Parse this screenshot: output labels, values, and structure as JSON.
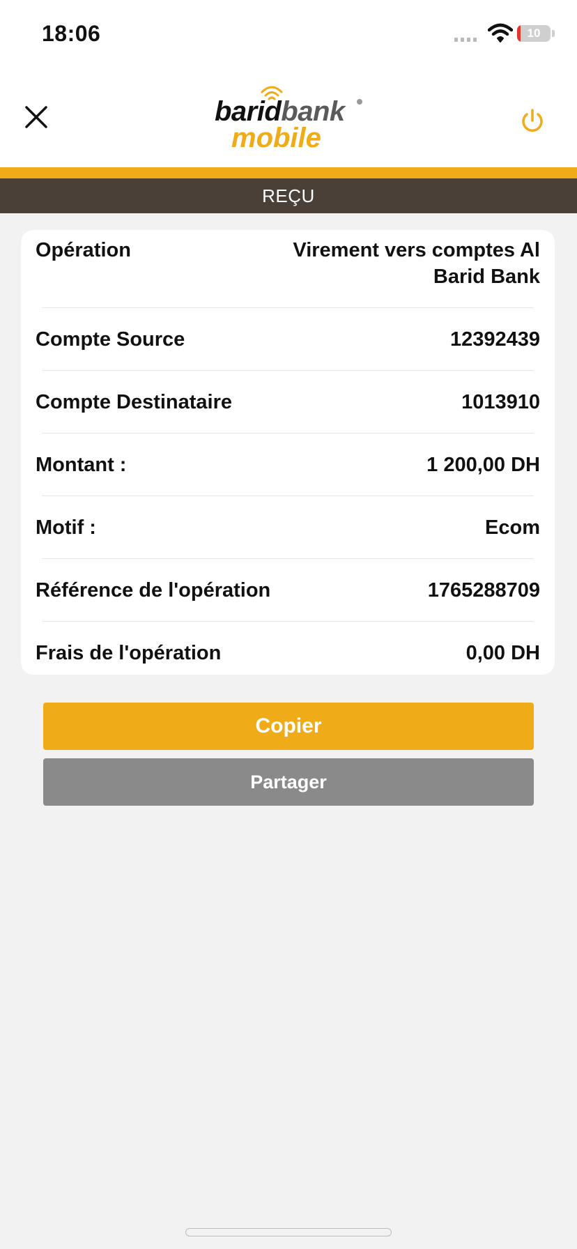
{
  "status_bar": {
    "time": "18:06",
    "battery": "10",
    "battery_level_fraction": 0.1
  },
  "header": {
    "logo_barid": "barid",
    "logo_bank": "bank",
    "logo_mobile": "mobile",
    "close_icon": "close-icon",
    "power_icon": "power-icon",
    "accent_color": "#f0ab18"
  },
  "title_bar": {
    "title": "REÇU"
  },
  "receipt": {
    "rows": [
      {
        "label": "Opération",
        "value": "Virement vers comptes Al Barid Bank"
      },
      {
        "label": "Compte Source",
        "value": "12392439"
      },
      {
        "label": "Compte Destinataire",
        "value": "1013910"
      },
      {
        "label": "Montant :",
        "value": "1 200,00 DH"
      },
      {
        "label": "Motif :",
        "value": "Ecom"
      },
      {
        "label": "Référence de l'opération",
        "value": "1765288709"
      },
      {
        "label": "Frais de l'opération",
        "value": "0,00 DH"
      }
    ]
  },
  "actions": {
    "copy_label": "Copier",
    "share_label": "Partager",
    "copy_color": "#f0ab18",
    "share_color": "#8a8a8a"
  }
}
